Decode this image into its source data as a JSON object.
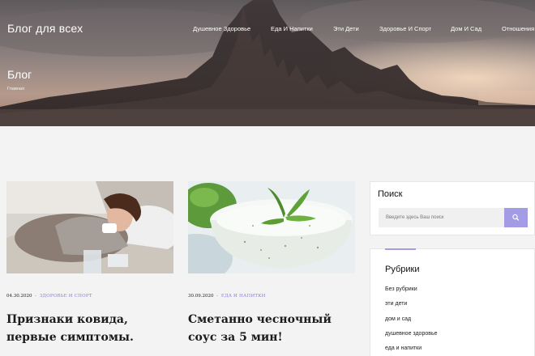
{
  "header": {
    "site_title": "Блог для всех",
    "nav": [
      {
        "label": "Душевное Здоровье"
      },
      {
        "label": "Еда И Напитки"
      },
      {
        "label": "Эти Дети"
      },
      {
        "label": "Здоровье И Спорт"
      },
      {
        "label": "Дом И Сад"
      },
      {
        "label": "Отношения"
      }
    ]
  },
  "hero": {
    "heading": "Блог",
    "breadcrumb": "Главная"
  },
  "posts": [
    {
      "date": "04.30.2020",
      "separator": "-",
      "category": "Здоровье и спорт",
      "title": "Признаки ковида, первые симптомы."
    },
    {
      "date": "30.09.2020",
      "separator": "-",
      "category": "Еда и напитки",
      "title": "Сметанно чесночный соус за 5 мин!"
    }
  ],
  "sidebar": {
    "search": {
      "title": "Поиск",
      "placeholder": "Введите здесь Ваш поиск",
      "icon": "search-icon"
    },
    "categories": {
      "title": "Рубрики",
      "items": [
        "Без рубрики",
        "эти дети",
        "дом и сад",
        "душевное здоровье",
        "еда и напитки"
      ]
    }
  },
  "colors": {
    "accent": "#a39be3",
    "category_link": "#8a7fd8",
    "background": "#f3f3f3"
  }
}
